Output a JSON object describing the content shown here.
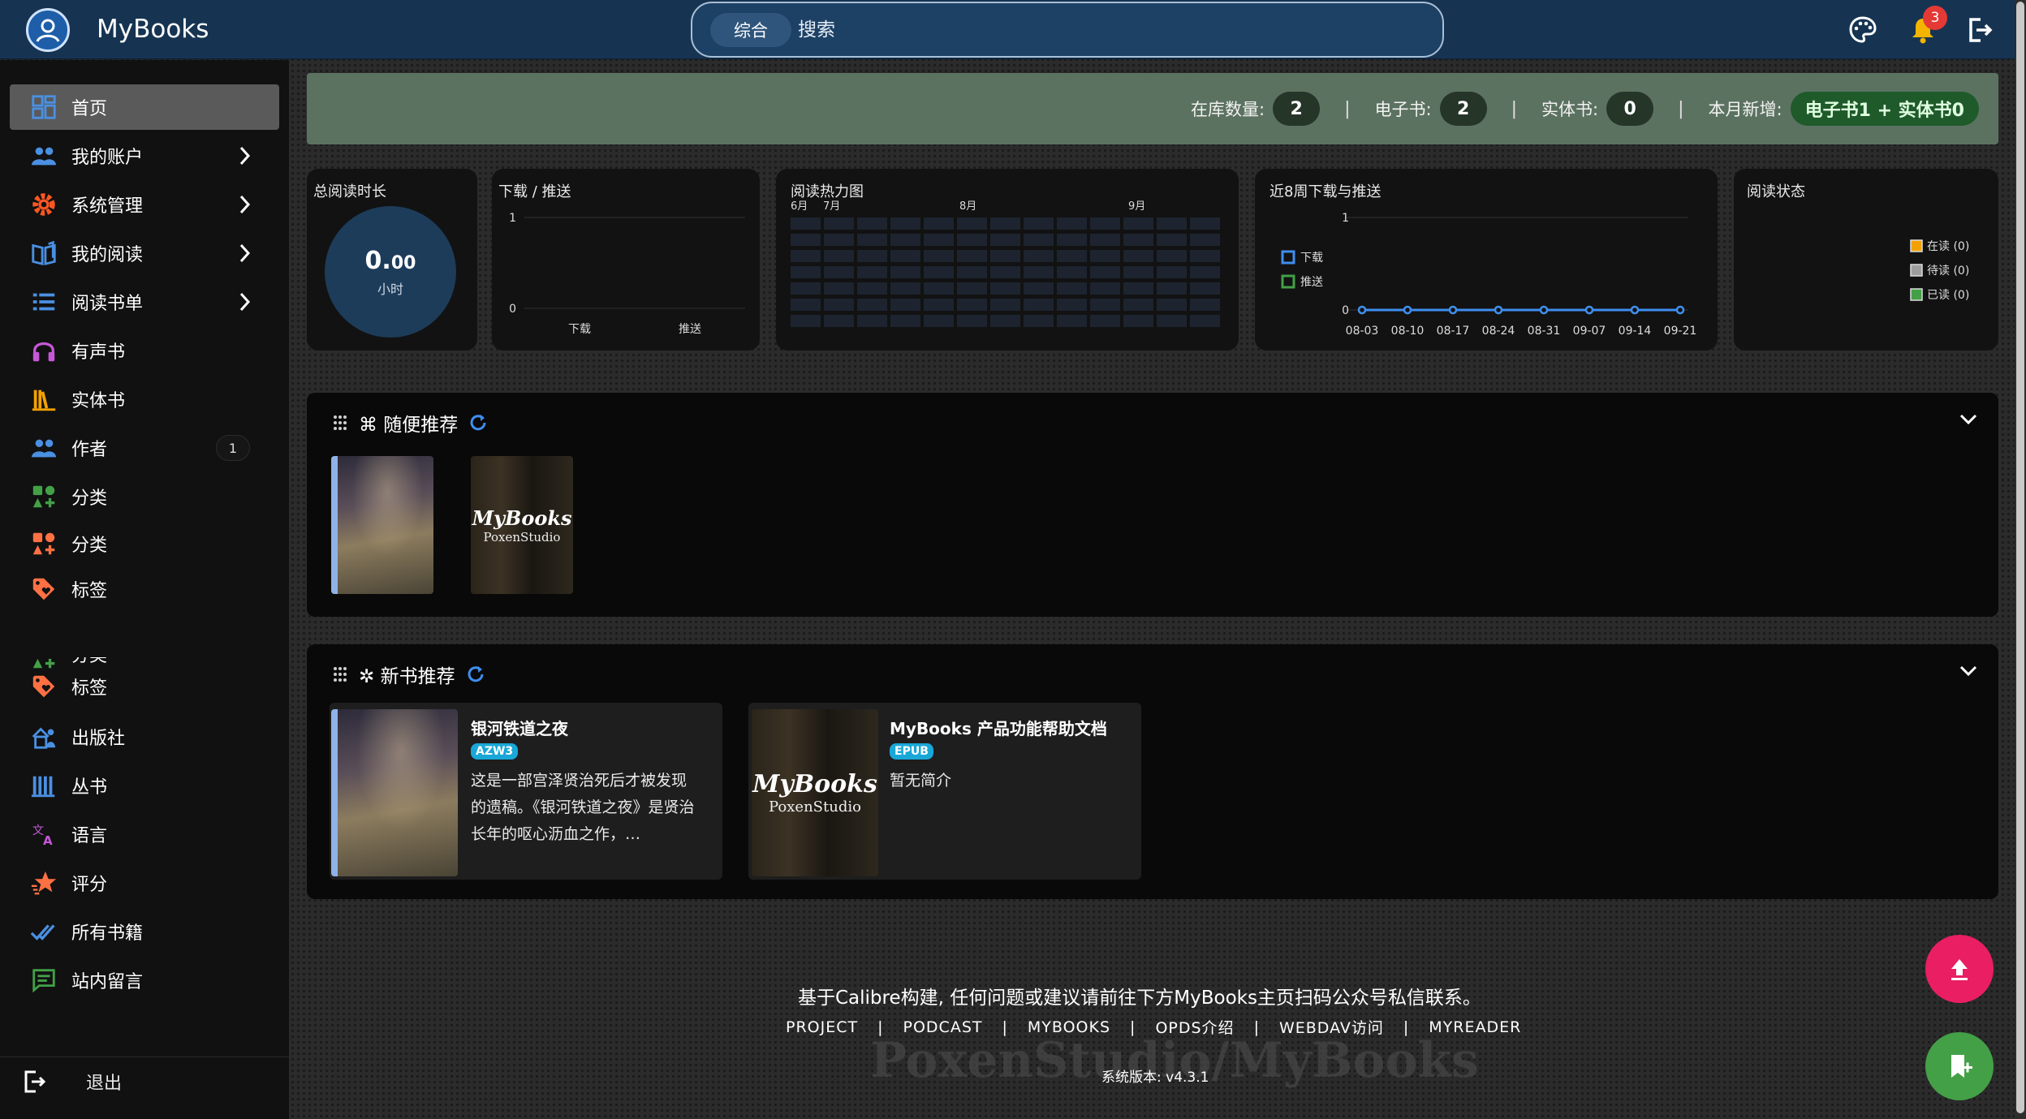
{
  "header": {
    "app_title": "MyBooks",
    "search_scope": "综合",
    "search_placeholder": "搜索",
    "notification_count": "3",
    "icons": [
      "user-avatar-icon",
      "palette-icon",
      "bell-icon",
      "logout-icon"
    ]
  },
  "sidebar": {
    "items": [
      {
        "label": "首页",
        "icon": "dashboard-icon",
        "color": "#4a90e2"
      },
      {
        "label": "我的账户",
        "icon": "users-icon",
        "color": "#4a90e2"
      },
      {
        "label": "系统管理",
        "icon": "gear-icon",
        "color": "#ff5722"
      },
      {
        "label": "我的阅读",
        "icon": "book-open-icon",
        "color": "#4a90e2"
      },
      {
        "label": "阅读书单",
        "icon": "list-icon",
        "color": "#4a90e2"
      },
      {
        "label": "有声书",
        "icon": "headphones-icon",
        "color": "#c658d8"
      },
      {
        "label": "实体书",
        "icon": "bookshelf-icon",
        "color": "#f4a100"
      },
      {
        "label": "作者",
        "icon": "people-icon",
        "color": "#4a90e2",
        "count": "1"
      },
      {
        "label": "分类",
        "icon": "category-icon",
        "color": "#43a047"
      },
      {
        "label": "分类",
        "icon": "category-icon",
        "color": "#ff7043"
      },
      {
        "label": "标签",
        "icon": "tag-icon",
        "color": "#ff7043"
      },
      {
        "label": "分类",
        "icon": "category-icon",
        "color": "#43a047"
      },
      {
        "label": "标签",
        "icon": "tag-icon",
        "color": "#ff7043"
      },
      {
        "label": "出版社",
        "icon": "publisher-icon",
        "color": "#4a90e2"
      },
      {
        "label": "丛书",
        "icon": "series-icon",
        "color": "#4a90e2"
      },
      {
        "label": "语言",
        "icon": "translate-icon",
        "color": "#c658d8"
      },
      {
        "label": "评分",
        "icon": "star-icon",
        "color": "#ff7043"
      },
      {
        "label": "所有书籍",
        "icon": "double-check-icon",
        "color": "#4a90e2"
      },
      {
        "label": "站内留言",
        "icon": "message-icon",
        "color": "#43a047"
      }
    ],
    "logout_label": "退出"
  },
  "stats": {
    "in_library_label": "在库数量:",
    "in_library": "2",
    "ebook_label": "电子书:",
    "ebook": "2",
    "physical_label": "实体书:",
    "physical": "0",
    "month_new_label": "本月新增:",
    "month_new": "电子书1 + 实体书0"
  },
  "cards": {
    "reading_time": {
      "title": "总阅读时长",
      "value_int": "0.",
      "value_dec": "00",
      "unit": "小时"
    },
    "download_push": {
      "title": "下载 / 推送"
    },
    "heatmap": {
      "title": "阅读热力图",
      "months": [
        "6月",
        "7月",
        "8月",
        "9月"
      ]
    },
    "weekly": {
      "title": "近8周下载与推送",
      "legend": [
        "下载",
        "推送"
      ]
    },
    "reading_status": {
      "title": "阅读状态",
      "legend": [
        "在读 (0)",
        "待读 (0)",
        "已读 (0)"
      ]
    }
  },
  "chart_data": [
    {
      "type": "bar",
      "title": "下载 / 推送",
      "categories": [
        "下载",
        "推送"
      ],
      "values": [
        0,
        0
      ],
      "ylim": [
        0,
        1
      ],
      "yticks": [
        "1",
        "0"
      ]
    },
    {
      "type": "heatmap",
      "title": "阅读热力图",
      "x_labels": [
        "6月",
        "7月",
        "8月",
        "9月"
      ],
      "rows": 7,
      "cols": 13,
      "values": "all zero"
    },
    {
      "type": "line",
      "title": "近8周下载与推送",
      "categories": [
        "08-03",
        "08-10",
        "08-17",
        "08-24",
        "08-31",
        "09-07",
        "09-14",
        "09-21"
      ],
      "series": [
        {
          "name": "下载",
          "values": [
            0,
            0,
            0,
            0,
            0,
            0,
            0,
            0
          ]
        },
        {
          "name": "推送",
          "values": [
            0,
            0,
            0,
            0,
            0,
            0,
            0,
            0
          ]
        }
      ],
      "ylim": [
        0,
        1
      ],
      "yticks": [
        "1",
        "0"
      ]
    },
    {
      "type": "pie",
      "title": "阅读状态",
      "categories": [
        "在读 (0)",
        "待读 (0)",
        "已读 (0)"
      ],
      "values": [
        0,
        0,
        0
      ]
    }
  ],
  "random_section": {
    "title": "⌘ 随便推荐"
  },
  "new_section": {
    "title": "✲ 新书推荐",
    "books": [
      {
        "title": "银河铁道之夜",
        "format": "AZW3",
        "desc": "这是一部宫泽贤治死后才被发现的遗稿。《银河铁道之夜》是贤治长年的呕心沥血之作，…"
      },
      {
        "title": "MyBooks 产品功能帮助文档",
        "format": "EPUB",
        "desc": "暂无简介"
      }
    ]
  },
  "cover_text": {
    "brand": "MyBooks",
    "sub": "PoxenStudio"
  },
  "footer": {
    "main": "基于Calibre构建, 任何问题或建议请前往下方MyBooks主页扫码公众号私信联系。",
    "links": [
      "PROJECT",
      "PODCAST",
      "MYBOOKS",
      "OPDS介绍",
      "WEBDAV访问",
      "MYREADER"
    ],
    "watermark": "PoxenStudio/MyBooks",
    "version": "系统版本: v4.3.1"
  },
  "colors": {
    "topbar": "#163452",
    "accent_blue": "#4a90e2",
    "fab_pink": "#e91e63",
    "fab_green": "#43a047",
    "stats_bg": "#5c7260"
  }
}
